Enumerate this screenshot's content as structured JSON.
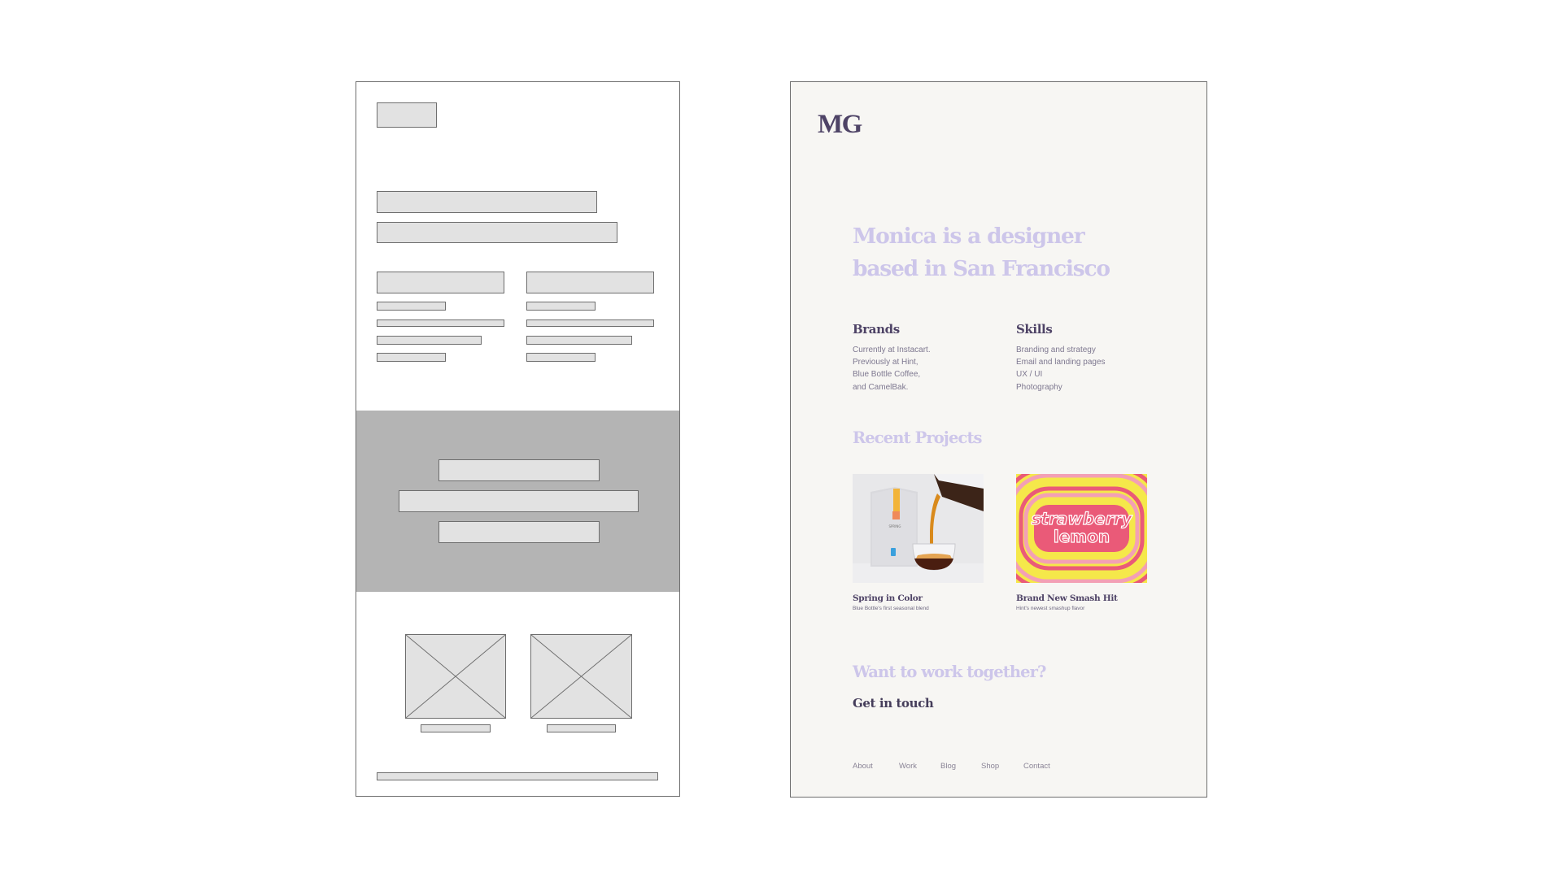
{
  "wireframe": {
    "label": "Low-fidelity wireframe",
    "blocks": [
      "logo",
      "headline-line-1",
      "headline-line-2",
      "column-1-heading",
      "column-2-heading"
    ],
    "projects_count": 2
  },
  "design": {
    "logo": "MG",
    "hero": {
      "line1": "Monica is a designer",
      "line2": "based in San Francisco"
    },
    "brands": {
      "heading": "Brands",
      "lines": [
        "Currently at Instacart.",
        "Previously at Hint,",
        "Blue Bottle Coffee,",
        "and CamelBak."
      ]
    },
    "skills": {
      "heading": "Skills",
      "lines": [
        "Branding and strategy",
        "Email and landing pages",
        "UX / UI",
        "Photography"
      ]
    },
    "recent_projects": {
      "heading": "Recent Projects",
      "items": [
        {
          "title": "Spring in Color",
          "subtitle": "Blue Bottle's first seasonal blend",
          "image": "coffee-pour-photo",
          "bag_label": "SPRING"
        },
        {
          "title": "Brand New Smash Hit",
          "subtitle": "Hint's newest smashup flavor",
          "image": "strawberry-lemon-art",
          "art_line1": "strawberry",
          "art_line2": "lemon"
        }
      ]
    },
    "contact": {
      "heading": "Want to work together?",
      "cta": "Get in touch"
    },
    "footer_nav": [
      "About",
      "Work",
      "Blog",
      "Shop",
      "Contact"
    ],
    "colors": {
      "accent_lavender": "#cdc6ea",
      "heading_purple": "#4e4366",
      "body_gray": "#7e7890",
      "background": "#f7f6f3",
      "art_pink": "#ea5a78",
      "art_light_pink": "#f3a0b5",
      "art_yellow": "#f5e84a"
    }
  }
}
